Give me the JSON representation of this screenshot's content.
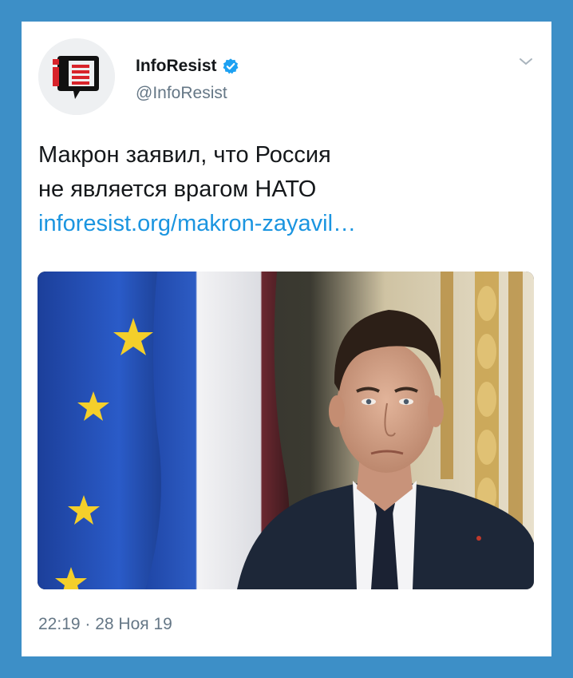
{
  "tweet": {
    "display_name": "InfoResist",
    "handle": "@InfoResist",
    "text_line1": "Макрон заявил, что Россия",
    "text_line2": "не является врагом НАТО",
    "link": "inforesist.org/makron-zayavil…",
    "timestamp": "22:19 · 28 Ноя 19",
    "verified": true
  },
  "icons": {
    "avatar": "inforesist-logo",
    "verified": "verified-badge-icon",
    "menu": "chevron-down-icon"
  },
  "colors": {
    "background": "#3d8fc7",
    "card": "#ffffff",
    "link": "#1b95e0",
    "verified": "#1da1f2",
    "muted": "#657786",
    "text": "#14171a"
  }
}
